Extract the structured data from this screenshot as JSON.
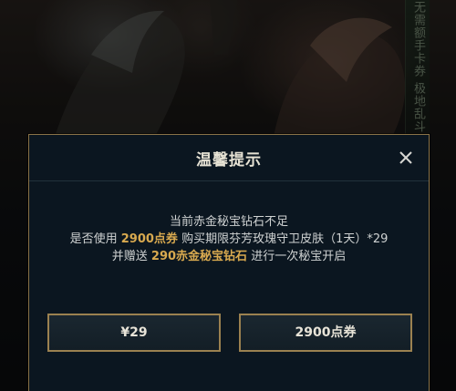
{
  "background": {
    "banner_text": "无需额手卡券 极地乱斗"
  },
  "dialog": {
    "title": "温馨提示",
    "close_icon": "close-icon",
    "message": {
      "line1": "当前赤金秘宝钻石不足",
      "line2_prefix": "是否使用 ",
      "line2_highlight": "2900点券",
      "line2_suffix": " 购买期限芬芳玫瑰守卫皮肤（1天）*29",
      "line3_prefix": "并赠送 ",
      "line3_highlight": "290赤金秘宝钻石",
      "line3_suffix": " 进行一次秘宝开启"
    },
    "buttons": {
      "pay_rmb": "¥29",
      "pay_points": "2900点券"
    }
  },
  "colors": {
    "accent_gold": "#d8a94f",
    "border_gold": "#9b8150",
    "dialog_bg": "#0b1620"
  }
}
